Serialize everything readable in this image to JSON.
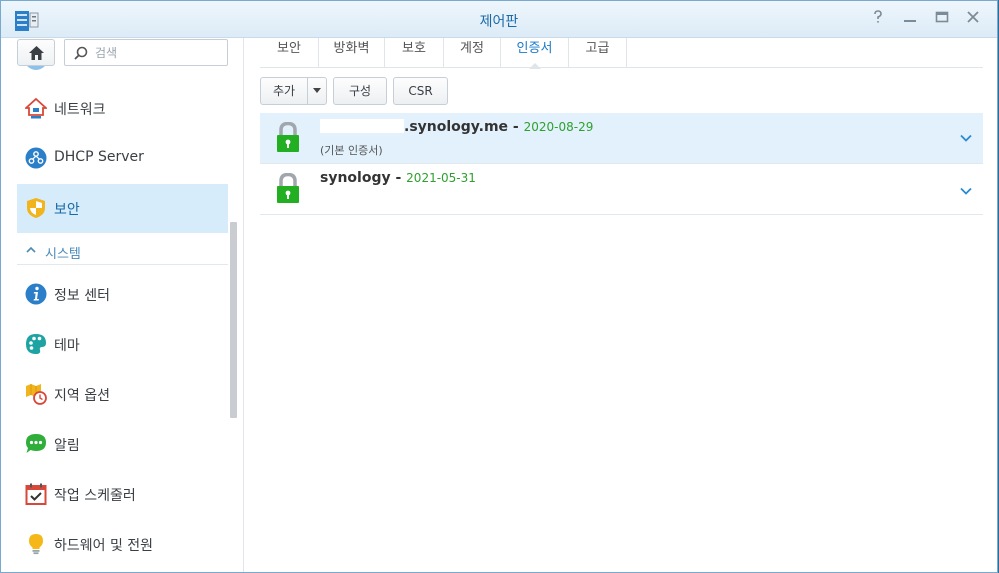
{
  "window": {
    "title": "제어판",
    "help_icon": "help-icon",
    "minimize_icon": "minimize-icon",
    "maximize_icon": "maximize-icon",
    "close_icon": "close-icon"
  },
  "sidebar": {
    "search_placeholder": "검색",
    "items": [
      {
        "label": "네트워크",
        "icon": "network-house-icon"
      },
      {
        "label": "DHCP Server",
        "icon": "dhcp-server-icon"
      },
      {
        "label": "보안",
        "icon": "shield-icon",
        "active": true
      }
    ],
    "section": {
      "label": "시스템"
    },
    "system_items": [
      {
        "label": "정보 센터",
        "icon": "info-icon"
      },
      {
        "label": "테마",
        "icon": "palette-icon"
      },
      {
        "label": "지역 옵션",
        "icon": "region-map-clock-icon"
      },
      {
        "label": "알림",
        "icon": "chat-bubble-icon"
      },
      {
        "label": "작업 스케줄러",
        "icon": "calendar-check-icon"
      },
      {
        "label": "하드웨어 및 전원",
        "icon": "lightbulb-icon"
      }
    ]
  },
  "tabs": [
    {
      "label": "보안"
    },
    {
      "label": "방화벽"
    },
    {
      "label": "보호"
    },
    {
      "label": "계정"
    },
    {
      "label": "인증서",
      "active": true
    },
    {
      "label": "고급"
    }
  ],
  "toolbar": {
    "add_label": "추가",
    "configure_label": "구성",
    "csr_label": "CSR"
  },
  "certificates": [
    {
      "name": ".synology.me",
      "date": "2020-08-29",
      "subtitle": "(기본 인증서)",
      "selected": true
    },
    {
      "name": "synology",
      "date": "2021-05-31"
    }
  ],
  "colors": {
    "accent": "#1a7ac8",
    "active_bg": "#d6ecfa",
    "selected_row_bg": "#e2f1fb",
    "date_green": "#2fa02f",
    "lock_green": "#20b020"
  }
}
